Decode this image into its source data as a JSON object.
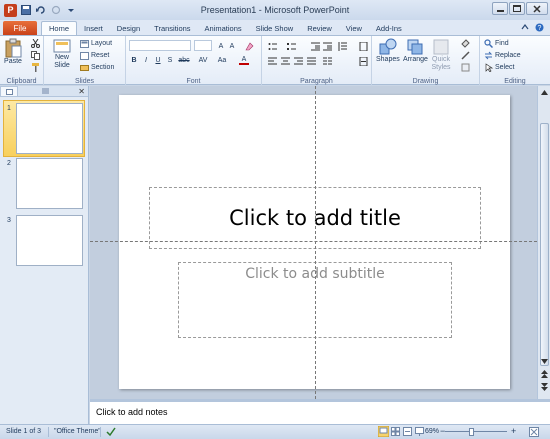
{
  "window": {
    "title": "Presentation1  -  Microsoft PowerPoint",
    "app_icon": "P"
  },
  "tabs": {
    "file": "File",
    "items": [
      "Home",
      "Insert",
      "Design",
      "Transitions",
      "Animations",
      "Slide Show",
      "Review",
      "View",
      "Add-Ins"
    ],
    "active": "Home"
  },
  "ribbon": {
    "clipboard": {
      "label": "Clipboard",
      "paste": "Paste"
    },
    "slides": {
      "label": "Slides",
      "new_slide": "New Slide",
      "layout": "Layout",
      "reset": "Reset",
      "section": "Section"
    },
    "font": {
      "label": "Font",
      "bold": "B",
      "italic": "I",
      "underline": "U",
      "shadow": "S",
      "strike": "abc",
      "spacing": "AV",
      "case": "Aa",
      "color": "A"
    },
    "paragraph": {
      "label": "Paragraph"
    },
    "drawing": {
      "label": "Drawing",
      "shapes": "Shapes",
      "arrange": "Arrange",
      "quick_styles": "Quick Styles"
    },
    "editing": {
      "label": "Editing",
      "find": "Find",
      "replace": "Replace",
      "select": "Select"
    }
  },
  "thumbnails": [
    {
      "number": "1",
      "selected": true
    },
    {
      "number": "2",
      "selected": false
    },
    {
      "number": "3",
      "selected": false
    }
  ],
  "slide": {
    "title_placeholder": "Click to add title",
    "subtitle_placeholder": "Click to add subtitle"
  },
  "notes": {
    "placeholder": "Click to add notes"
  },
  "status": {
    "slide_info": "Slide 1 of 3",
    "theme": "\"Office Theme\"",
    "zoom": "69%"
  },
  "colors": {
    "file_tab": "#c9421a",
    "accent": "#1e395b",
    "selected_thumb": "#f8d05d"
  }
}
